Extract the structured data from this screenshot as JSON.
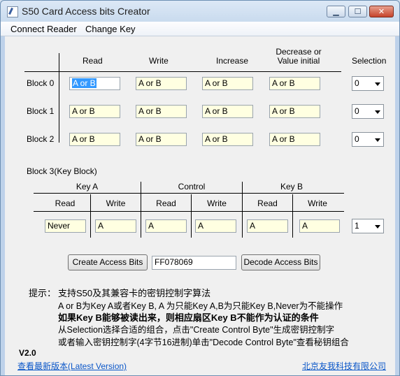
{
  "window": {
    "title": "S50 Card Access bits Creator"
  },
  "controls": {
    "minimize": "▁",
    "maximize": "☐",
    "close": "✕"
  },
  "menu": [
    "Connect Reader",
    "Change Key"
  ],
  "columns": {
    "read": "Read",
    "write": "Write",
    "increase": "Increase",
    "decrease": "Decrease or\nValue initial",
    "selection": "Selection"
  },
  "blocks": [
    {
      "label": "Block 0",
      "read": "A or B",
      "write": "A or B",
      "increase": "A or B",
      "decrease": "A or B",
      "selection": "0"
    },
    {
      "label": "Block 1",
      "read": "A or B",
      "write": "A or B",
      "increase": "A or B",
      "decrease": "A or B",
      "selection": "0"
    },
    {
      "label": "Block 2",
      "read": "A or B",
      "write": "A or B",
      "increase": "A or B",
      "decrease": "A or B",
      "selection": "0"
    }
  ],
  "block3": {
    "title": "Block 3(Key Block)",
    "groups": [
      "Key A",
      "Control",
      "Key B"
    ],
    "sub": [
      "Read",
      "Write",
      "Read",
      "Write",
      "Read",
      "Write"
    ],
    "values": [
      "Never",
      "A",
      "A",
      "A",
      "A",
      "A"
    ],
    "selection": "1"
  },
  "actions": {
    "create": "Create Access Bits",
    "code": "FF078069",
    "decode": "Decode Access Bits"
  },
  "notes": {
    "label": "提示：",
    "line1": "支持S50及其兼容卡的密钥控制字算法",
    "line2": "A or B为Key A或者Key B, A 为只能Key A,B为只能Key B,Never为不能操作",
    "line3": "如果Key B能够被读出来，则相应扇区Key B不能作为认证的条件",
    "line4": "从Selection选择合适的组合，点击\"Create Control Byte\"生成密钥控制字",
    "line5": "或者输入密钥控制字(4字节16进制)单击\"Decode Control Byte\"查看秘钥组合"
  },
  "footer": {
    "version": "V2.0",
    "link": "查看最新版本(Latest Version)",
    "company": "北京友我科技有限公司"
  }
}
